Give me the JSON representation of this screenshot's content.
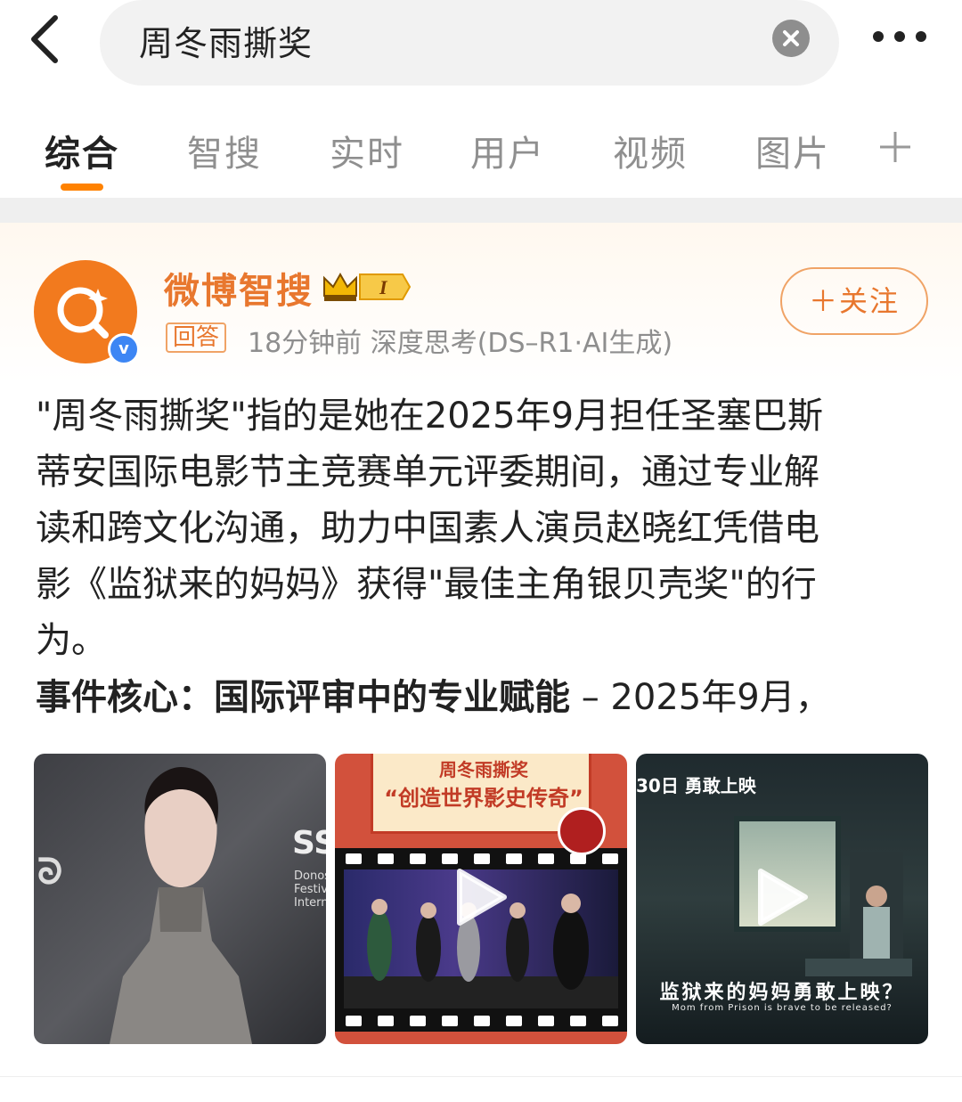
{
  "search": {
    "query": "周冬雨撕奖"
  },
  "tabs": [
    {
      "label": "综合"
    },
    {
      "label": "智搜"
    },
    {
      "label": "实时"
    },
    {
      "label": "用户"
    },
    {
      "label": "视频"
    },
    {
      "label": "图片"
    }
  ],
  "post": {
    "author": "微博智搜",
    "level_badge": "I",
    "tag": "回答",
    "meta": "18分钟前  深度思考(DS–R1·AI生成)",
    "follow_label": "＋关注",
    "body_lines": [
      "\"周冬雨撕奖\"指的是她在2025年9月担任圣塞巴斯",
      "蒂安国际电影节主竞赛单元评委期间，通过专业解",
      "读和跨文化沟通，助力中国素人演员赵晓红凭借电",
      "影《监狱来的妈妈》获得\"最佳主角银贝壳奖\"的行",
      "为。"
    ],
    "subhead_bold": "事件核心：国际评审中的专业赋能",
    "subhead_rest": " – 2025年9月，"
  },
  "thumbnails": {
    "t1": {
      "logo_text": "SS",
      "sign_text": "Donos\nFestiv\nIntern"
    },
    "t2": {
      "title": "周冬雨撕奖",
      "subtitle": "“创造世界影史传奇”"
    },
    "t3": {
      "top_text": "30日 勇敢上映",
      "caption": "监狱来的妈妈勇敢上映？",
      "caption_en": "Mom from Prison is brave to be released?"
    }
  },
  "colors": {
    "accent": "#ff8200",
    "brand_orange": "#e8772e",
    "verify_blue": "#3d86f4"
  }
}
